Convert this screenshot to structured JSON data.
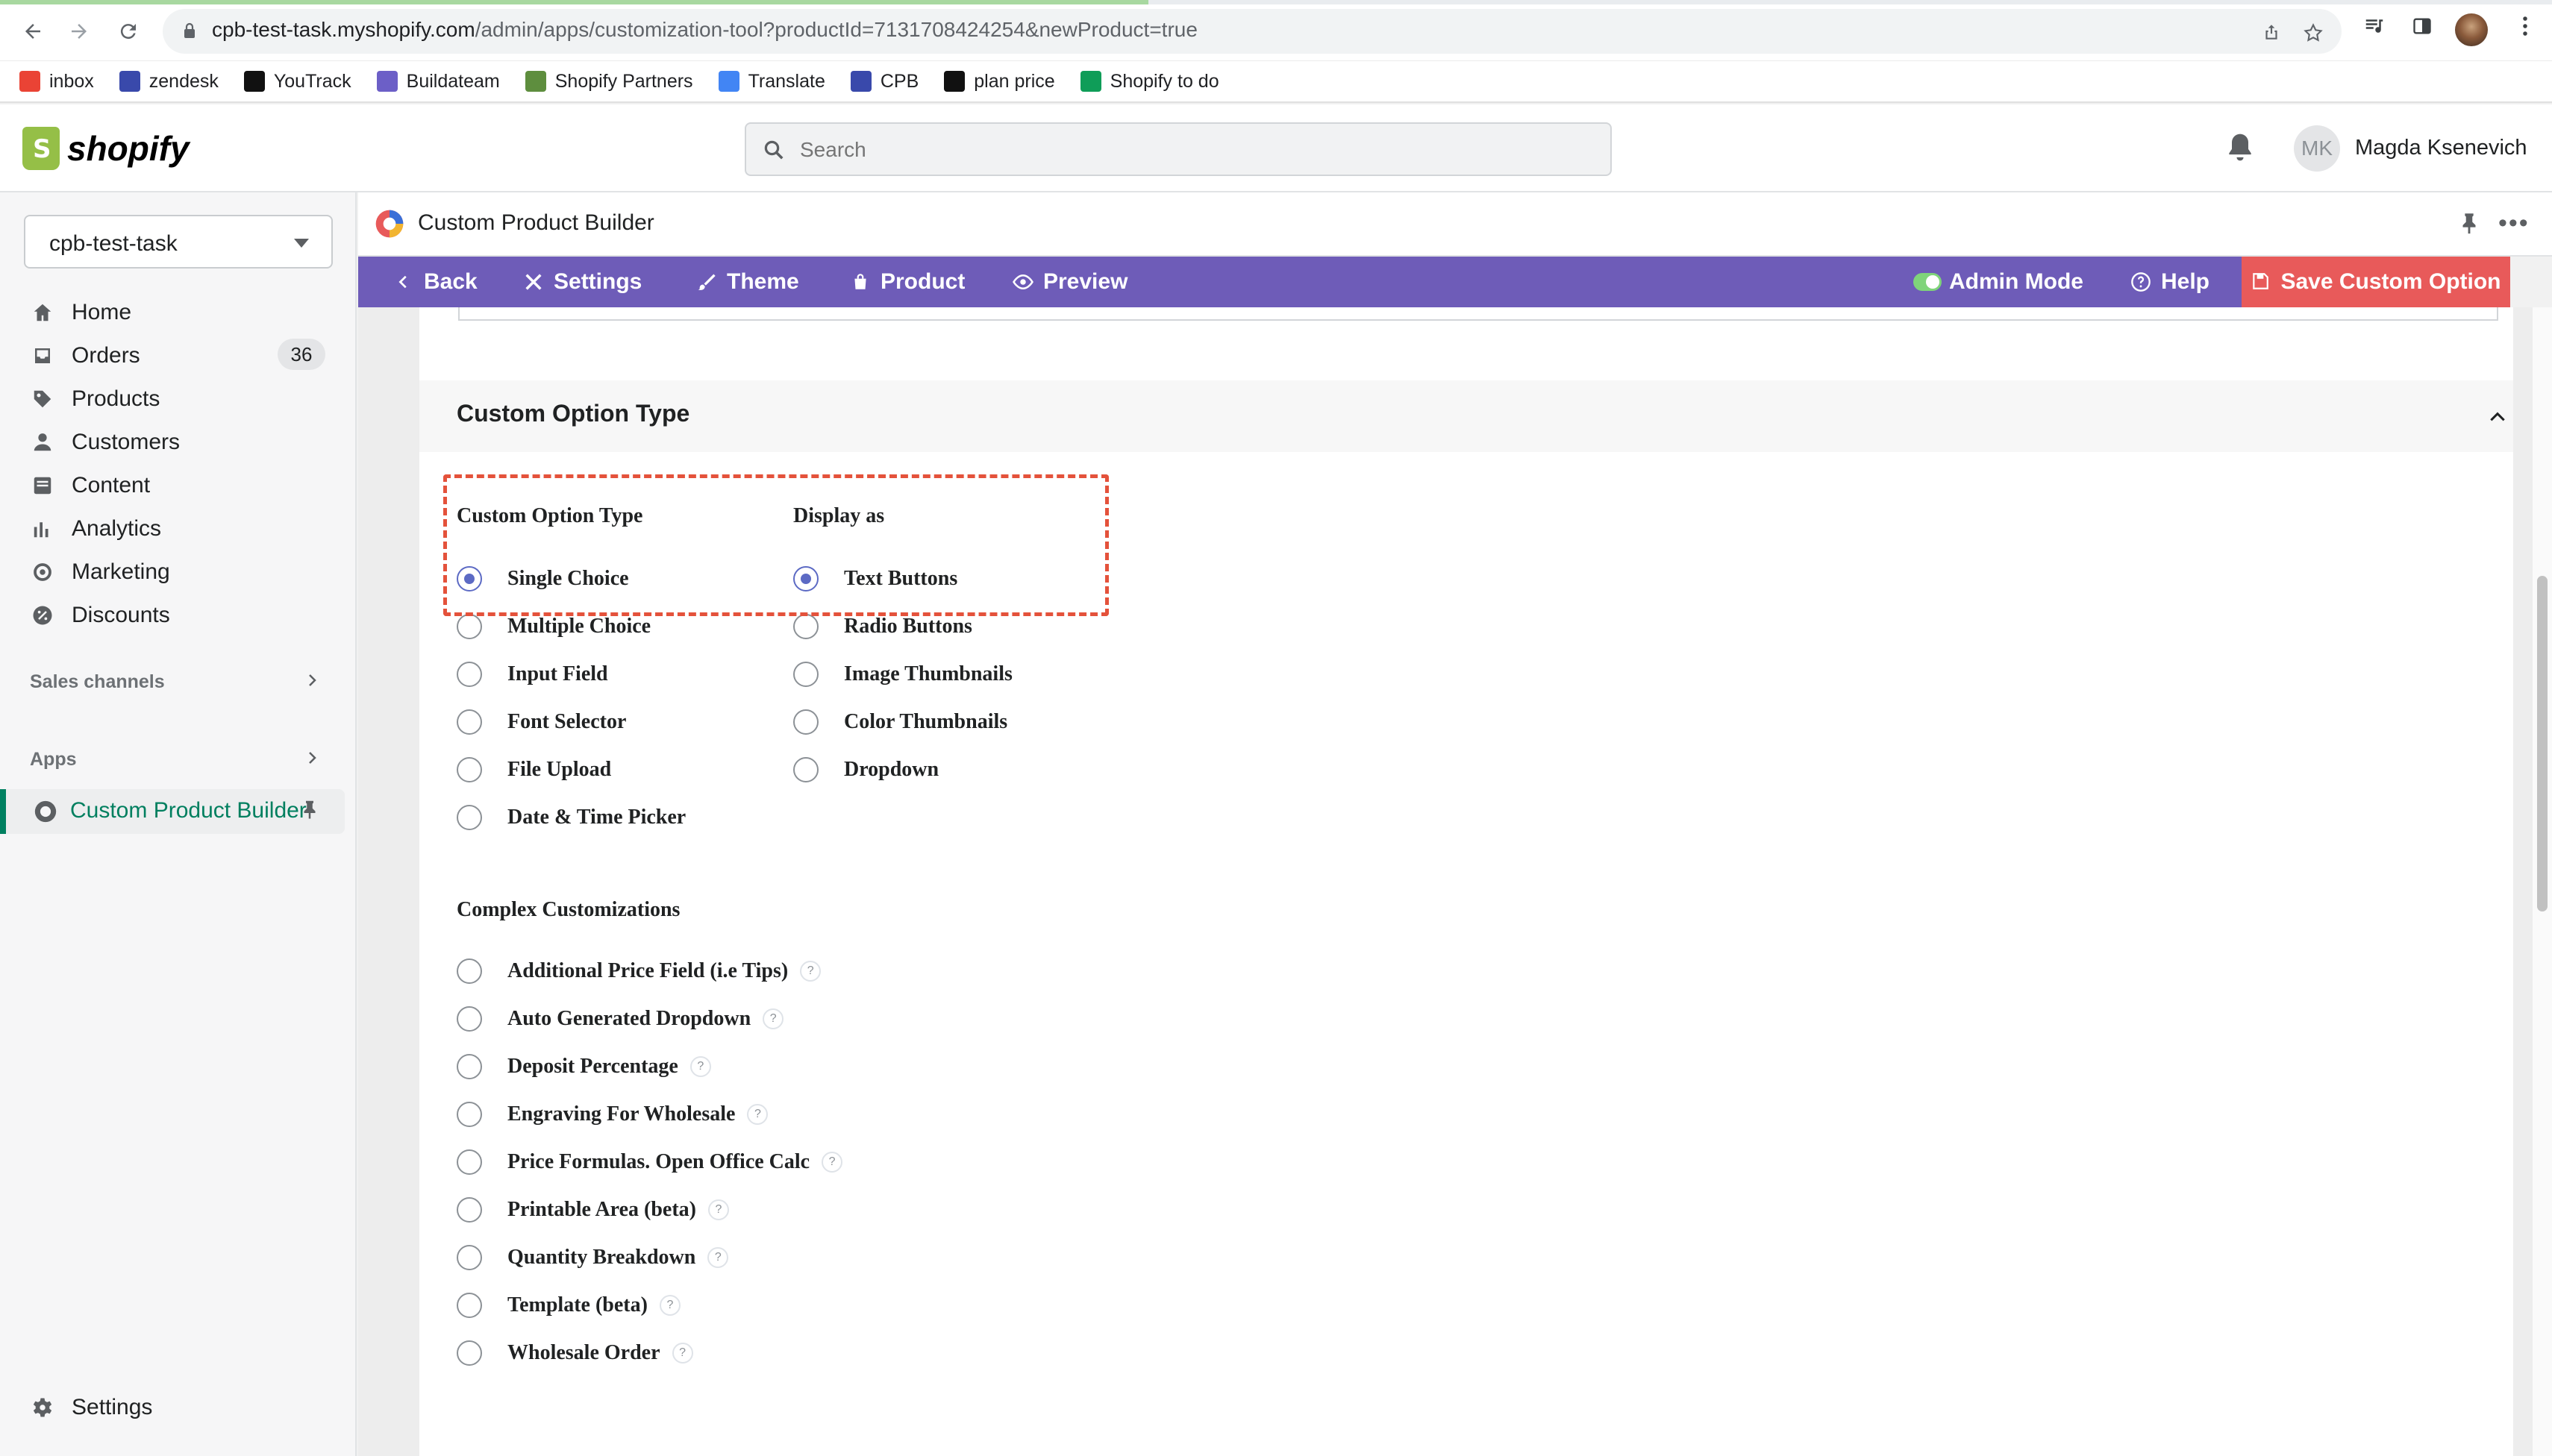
{
  "browser": {
    "url_host": "cpb-test-task.myshopify.com",
    "url_path": "/admin/apps/customization-tool?productId=7131708424254&newProduct=true",
    "loading_progress": 0.45,
    "bookmarks": [
      {
        "label": "inbox",
        "color": "#ea4335"
      },
      {
        "label": "zendesk",
        "color": "#3949ab"
      },
      {
        "label": "YouTrack",
        "color": "#111111"
      },
      {
        "label": "Buildateam",
        "color": "#6c5fc7"
      },
      {
        "label": "Shopify Partners",
        "color": "#5e8e3e"
      },
      {
        "label": "Translate",
        "color": "#4285f4"
      },
      {
        "label": "CPB",
        "color": "#3949ab"
      },
      {
        "label": "plan price",
        "color": "#111111"
      },
      {
        "label": "Shopify to do",
        "color": "#0f9d58"
      }
    ]
  },
  "shopify": {
    "logo_text": "shopify",
    "search_placeholder": "Search",
    "user_initials": "MK",
    "user_name": "Magda Ksenevich"
  },
  "sidebar": {
    "store": "cpb-test-task",
    "items": [
      {
        "label": "Home",
        "icon": "home-icon"
      },
      {
        "label": "Orders",
        "icon": "orders-icon",
        "badge": "36"
      },
      {
        "label": "Products",
        "icon": "tag-icon"
      },
      {
        "label": "Customers",
        "icon": "person-icon"
      },
      {
        "label": "Content",
        "icon": "content-icon"
      },
      {
        "label": "Analytics",
        "icon": "analytics-icon"
      },
      {
        "label": "Marketing",
        "icon": "target-icon"
      },
      {
        "label": "Discounts",
        "icon": "discount-icon"
      }
    ],
    "sales_channels": "Sales channels",
    "apps": "Apps",
    "active_app": "Custom Product Builder",
    "settings": "Settings"
  },
  "app": {
    "title": "Custom Product Builder",
    "toolbar": {
      "back": "Back",
      "settings": "Settings",
      "theme": "Theme",
      "product": "Product",
      "preview": "Preview",
      "admin_mode": "Admin Mode",
      "help": "Help",
      "save": "Save Custom Option"
    },
    "section_title": "Custom Option Type",
    "option_type_heading": "Custom Option Type",
    "display_as_heading": "Display as",
    "option_types": [
      {
        "label": "Single Choice",
        "selected": true
      },
      {
        "label": "Multiple Choice",
        "selected": false
      },
      {
        "label": "Input Field",
        "selected": false
      },
      {
        "label": "Font Selector",
        "selected": false
      },
      {
        "label": "File Upload",
        "selected": false
      },
      {
        "label": "Date & Time Picker",
        "selected": false
      }
    ],
    "display_as": [
      {
        "label": "Text Buttons",
        "selected": true
      },
      {
        "label": "Radio Buttons",
        "selected": false
      },
      {
        "label": "Image Thumbnails",
        "selected": false
      },
      {
        "label": "Color Thumbnails",
        "selected": false
      },
      {
        "label": "Dropdown",
        "selected": false
      }
    ],
    "complex_heading": "Complex Customizations",
    "complex": [
      {
        "label": "Additional Price Field (i.e Tips)"
      },
      {
        "label": "Auto Generated Dropdown"
      },
      {
        "label": "Deposit Percentage"
      },
      {
        "label": "Engraving For Wholesale"
      },
      {
        "label": "Price Formulas. Open Office Calc"
      },
      {
        "label": "Printable Area (beta)"
      },
      {
        "label": "Quantity Breakdown"
      },
      {
        "label": "Template (beta)"
      },
      {
        "label": "Wholesale Order"
      }
    ],
    "help_glyph": "?"
  }
}
